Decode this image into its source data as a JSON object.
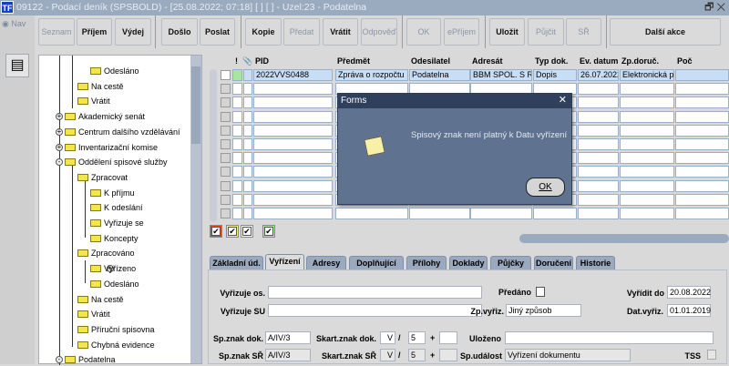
{
  "window": {
    "title": "09122 - Podací deník (SPSBOLD) - [25.08.2022; 07:18]  [ ]  [ ] - Uzel:23 - Podatelna",
    "logo": "TF",
    "nav_label": "Nav"
  },
  "toolbar": [
    {
      "label": "Seznam",
      "enabled": false
    },
    {
      "label": "Příjem",
      "enabled": true
    },
    {
      "label": "Výdej",
      "enabled": true
    },
    {
      "label": "Došlo",
      "enabled": true
    },
    {
      "label": "Poslat",
      "enabled": true
    },
    {
      "label": "Kopie",
      "enabled": true
    },
    {
      "label": "Předat",
      "enabled": false
    },
    {
      "label": "Vrátit",
      "enabled": true
    },
    {
      "label": "Odpověď",
      "enabled": false
    },
    {
      "label": "OK",
      "enabled": false
    },
    {
      "label": "ePříjem",
      "enabled": false
    },
    {
      "label": "Uložit",
      "enabled": true
    },
    {
      "label": "Půjčit",
      "enabled": false
    },
    {
      "label": "SŘ",
      "enabled": false
    },
    {
      "label": "Další akce",
      "enabled": true
    }
  ],
  "tree": [
    {
      "label": "Odesláno",
      "depth": 3
    },
    {
      "label": "Na cestě",
      "depth": 2
    },
    {
      "label": "Vrátit",
      "depth": 2
    },
    {
      "label": "Akademický senát",
      "depth": 1,
      "exp": "+"
    },
    {
      "label": "Centrum dalšího vzdělávání",
      "depth": 1,
      "exp": "+"
    },
    {
      "label": "Inventarizační komise",
      "depth": 1,
      "exp": "+"
    },
    {
      "label": "Oddělení spisové služby",
      "depth": 1,
      "exp": "-"
    },
    {
      "label": "Zpracovat",
      "depth": 2,
      "exp": "-"
    },
    {
      "label": "K příjmu",
      "depth": 3
    },
    {
      "label": "K odeslání",
      "depth": 3
    },
    {
      "label": "Vyřizuje se",
      "depth": 3
    },
    {
      "label": "Koncepty",
      "depth": 3
    },
    {
      "label": "Zpracováno",
      "depth": 2,
      "exp": "-"
    },
    {
      "label": "Vyřízeno",
      "depth": 3,
      "exp": "+"
    },
    {
      "label": "Odesláno",
      "depth": 3
    },
    {
      "label": "Na cestě",
      "depth": 2
    },
    {
      "label": "Vrátit",
      "depth": 2
    },
    {
      "label": "Příruční spisovna",
      "depth": 2,
      "exp": "+"
    },
    {
      "label": "Chybná evidence",
      "depth": 2,
      "exp": "+"
    },
    {
      "label": "Podatelna",
      "depth": 1,
      "exp": "-"
    }
  ],
  "grid": {
    "headers": [
      "!",
      "PID",
      "Předmět",
      "Odesilatel",
      "Adresát",
      "Typ dok.",
      "Ev. datum",
      "Zp.doruč.",
      "Poč"
    ],
    "rows": [
      [
        "2022VVS0488",
        "Zpráva o rozpočtu",
        "Podatelna",
        "BBM SPOL. S R. O",
        "Dopis",
        "26.07.2022",
        "Elektronická p",
        ""
      ]
    ],
    "empty_rows": 10
  },
  "tabs": [
    {
      "label": "Základní úd."
    },
    {
      "label": "Vyřízení",
      "active": true
    },
    {
      "label": "Adresy"
    },
    {
      "label": "Doplňující úd."
    },
    {
      "label": "Přílohy"
    },
    {
      "label": "Doklady"
    },
    {
      "label": "Půjčky"
    },
    {
      "label": "Doručení"
    },
    {
      "label": "Historie"
    }
  ],
  "form": {
    "vyrizuje_os": {
      "label": "Vyřizuje os.",
      "value": ""
    },
    "vyrizuje_su": {
      "label": "Vyřizuje SU",
      "value": ""
    },
    "predano": {
      "label": "Předáno",
      "checked": false
    },
    "vyridit_do": {
      "label": "Vyřídit do",
      "value": "20.08.2022"
    },
    "zp_vyriz": {
      "label": "Zp.vyřiz.",
      "value": "Jiný způsob"
    },
    "dat_vyriz": {
      "label": "Dat.vyřiz.",
      "value": "01.01.2019"
    },
    "sp_znak_dok": {
      "label": "Sp.znak dok.",
      "value": "A/IV/3"
    },
    "sp_znak_sr": {
      "label": "Sp.znak SŘ",
      "value": "A/IV/3"
    },
    "skart_dok": {
      "label": "Skart.znak dok.",
      "znak": "V",
      "lhuta": "5",
      "plus": ""
    },
    "skart_sr": {
      "label": "Skart.znak SŘ",
      "znak": "V",
      "lhuta": "5",
      "plus": ""
    },
    "slash": "/",
    "plus_sign": "+",
    "ulozeno": {
      "label": "Uloženo",
      "value": ""
    },
    "sp_udalost": {
      "label": "Sp.událost",
      "value": "Vyřízení dokumentu"
    },
    "tss": {
      "label": "TSS",
      "checked": false
    }
  },
  "dialog": {
    "title": "Forms",
    "message": "Spisový znak není platný k Datu vyřízení",
    "ok_label": "OK"
  },
  "colors": {
    "titlebar": "#9aaabf",
    "dialog": "#5f7391",
    "selected_row": "#c8def6",
    "flag_red": "#e0441c",
    "flag_yellow": "#f5ef8a",
    "flag_green": "#a8e6a0"
  }
}
